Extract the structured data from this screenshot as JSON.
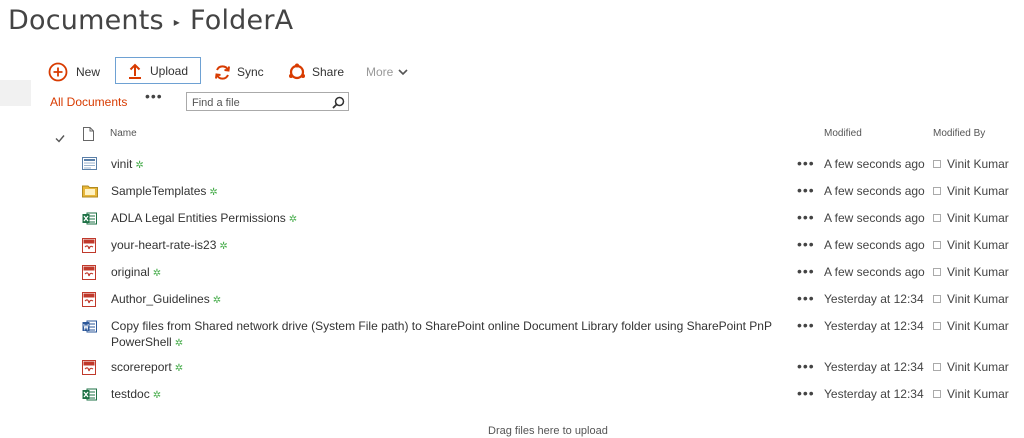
{
  "breadcrumb": {
    "root": "Documents",
    "current": "FolderA",
    "separator": "▸"
  },
  "toolbar": {
    "new_label": "New",
    "upload_label": "Upload",
    "sync_label": "Sync",
    "share_label": "Share",
    "more_label": "More"
  },
  "view": {
    "current": "All Documents",
    "menu": "•••"
  },
  "search": {
    "placeholder": "Find a file"
  },
  "columns": {
    "name": "Name",
    "modified": "Modified",
    "modified_by": "Modified By"
  },
  "row_menu": "•••",
  "new_marker": "✲",
  "files": [
    {
      "name": "vinit",
      "type": "page",
      "modified": "A few seconds ago",
      "modified_by": "Vinit Kumar"
    },
    {
      "name": "SampleTemplates",
      "type": "folder",
      "modified": "A few seconds ago",
      "modified_by": "Vinit Kumar"
    },
    {
      "name": "ADLA Legal Entities Permissions",
      "type": "excel",
      "modified": "A few seconds ago",
      "modified_by": "Vinit Kumar"
    },
    {
      "name": "your-heart-rate-is23",
      "type": "pdf",
      "modified": "A few seconds ago",
      "modified_by": "Vinit Kumar"
    },
    {
      "name": "original",
      "type": "pdf",
      "modified": "A few seconds ago",
      "modified_by": "Vinit Kumar"
    },
    {
      "name": "Author_Guidelines",
      "type": "pdf",
      "modified": "Yesterday at 12:34",
      "modified_by": "Vinit Kumar"
    },
    {
      "name": "Copy files from Shared network drive (System File path) to SharePoint online Document Library folder using SharePoint PnP",
      "name_line2": "PowerShell",
      "type": "word",
      "modified": "Yesterday at 12:34",
      "modified_by": "Vinit Kumar"
    },
    {
      "name": "scorereport",
      "type": "pdf",
      "modified": "Yesterday at 12:34",
      "modified_by": "Vinit Kumar"
    },
    {
      "name": "testdoc",
      "type": "excel",
      "modified": "Yesterday at 12:34",
      "modified_by": "Vinit Kumar"
    }
  ],
  "drag_hint": "Drag files here to upload",
  "colors": {
    "accent": "#d83b01",
    "excel": "#1e7145",
    "word": "#2b579a",
    "pdf": "#c0392b",
    "folder": "#e8b73a",
    "new_marker": "#4caf50"
  }
}
